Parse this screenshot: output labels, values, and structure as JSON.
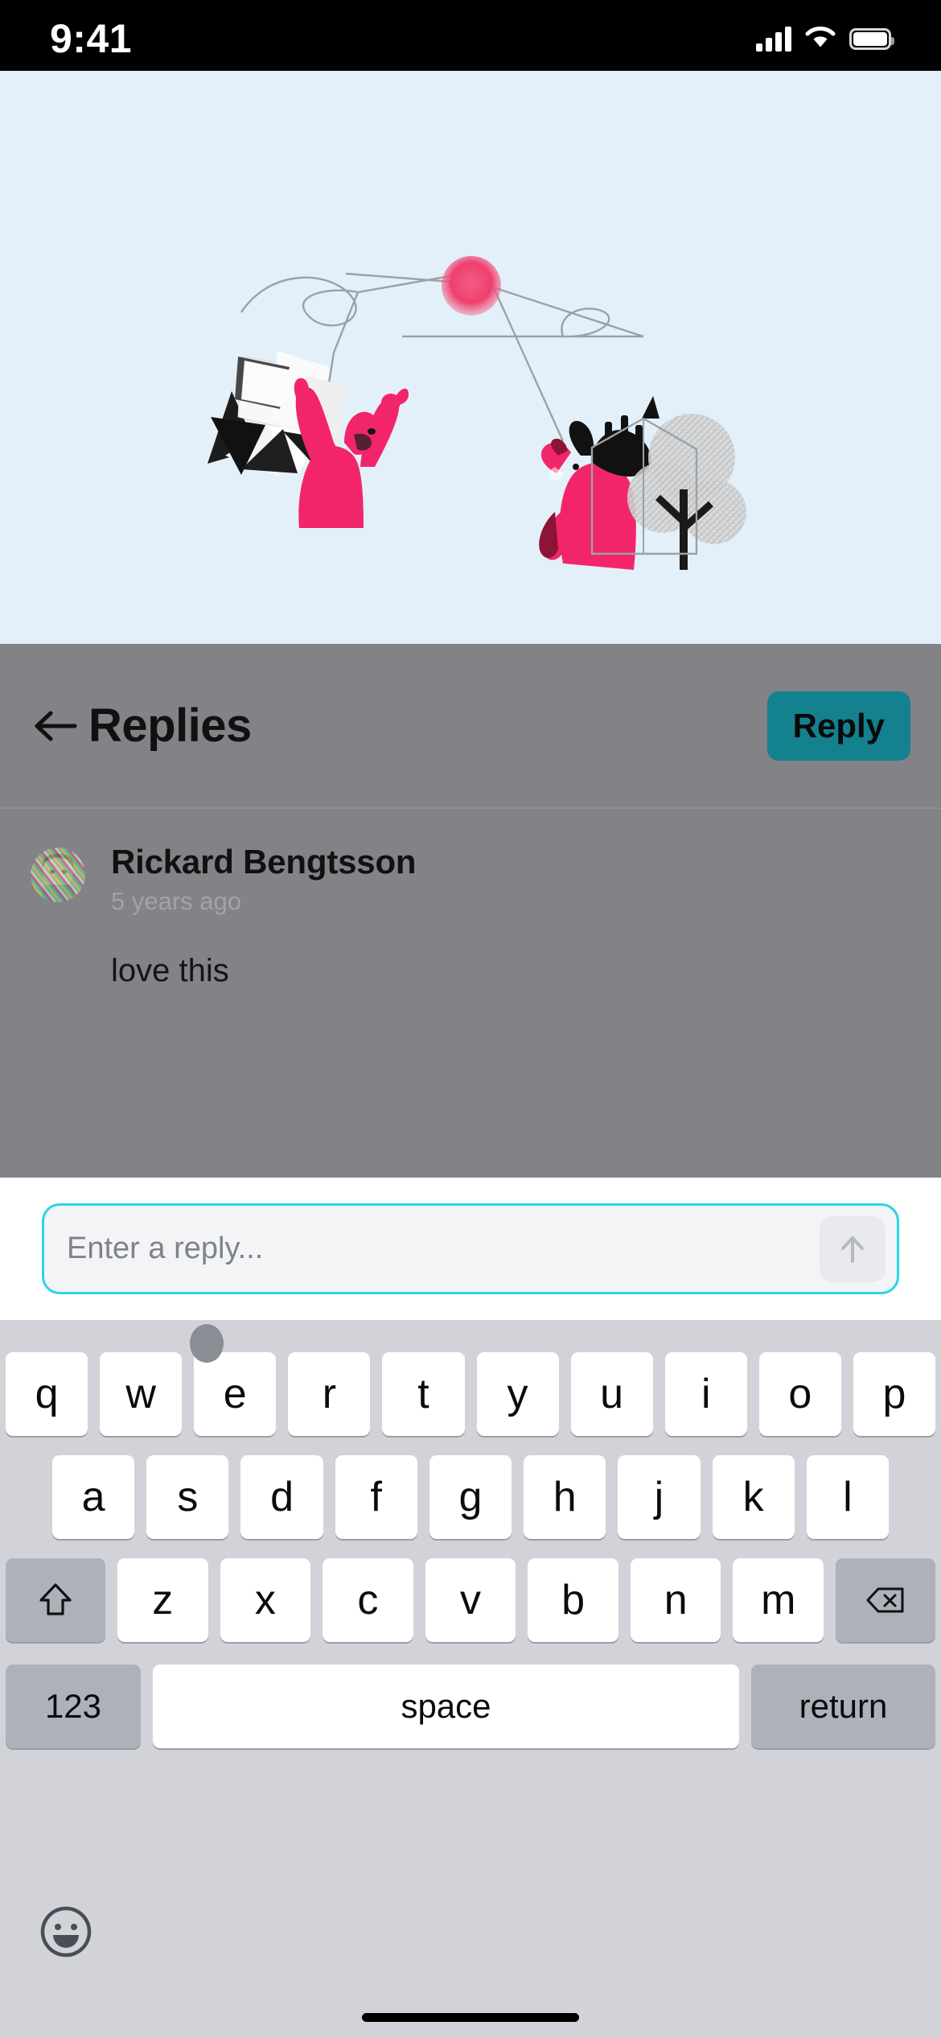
{
  "status_bar": {
    "time": "9:41",
    "cellular_icon": "cellular-signal-icon",
    "wifi_icon": "wifi-icon",
    "battery_icon": "battery-icon"
  },
  "illustration": {
    "alt": "Pink bear reaching for a pink balloon beside a pink moose and a gray tree",
    "background_color": "#e4f0f9",
    "balloon_color": "#f0527a",
    "animal_color": "#f2256b"
  },
  "header": {
    "back_icon": "back-arrow-icon",
    "title": "Replies",
    "reply_label": "Reply",
    "reply_color": "#14818f",
    "overlay_color": "#828287"
  },
  "comments": [
    {
      "author": "Rickard Bengtsson",
      "time": "5 years ago",
      "body": "love this",
      "avatar": "rainbow-striped-portrait"
    }
  ],
  "reply_bar": {
    "placeholder": "Enter a reply...",
    "value": "",
    "border_color": "#2ad4e8",
    "send_icon": "arrow-up-icon"
  },
  "keyboard": {
    "handle": "keyboard-drag-handle",
    "row1": [
      "q",
      "w",
      "e",
      "r",
      "t",
      "y",
      "u",
      "i",
      "o",
      "p"
    ],
    "row2": [
      "a",
      "s",
      "d",
      "f",
      "g",
      "h",
      "j",
      "k",
      "l"
    ],
    "row3": [
      "z",
      "x",
      "c",
      "v",
      "b",
      "n",
      "m"
    ],
    "shift_icon": "shift-icon",
    "backspace_icon": "backspace-icon",
    "numeric_label": "123",
    "space_label": "space",
    "return_label": "return",
    "emoji_icon": "emoji-smiley-icon",
    "background_color": "#d1d3d9",
    "key_color": "#ffffff",
    "modifier_color": "#aeb1ba"
  },
  "home_indicator": "home-indicator"
}
